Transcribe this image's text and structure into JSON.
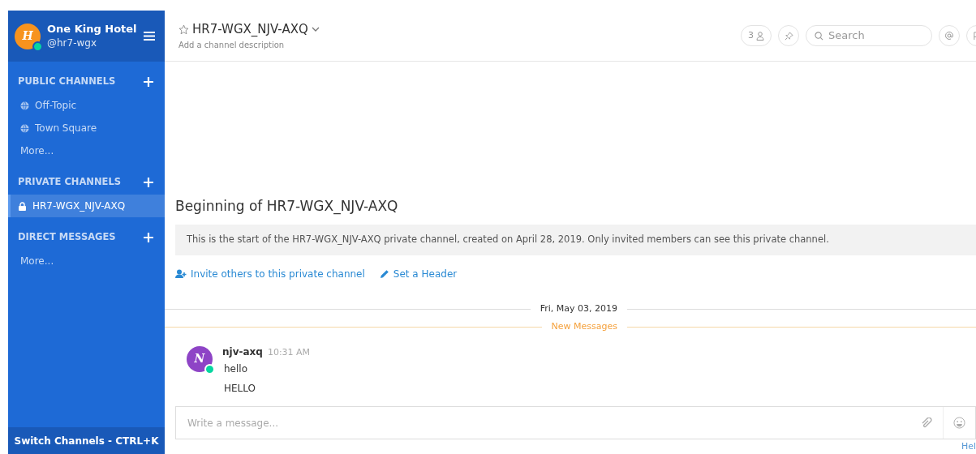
{
  "team": {
    "name": "One King Hotel",
    "username": "@hr7-wgx",
    "avatar_letter": "H",
    "online": true
  },
  "sidebar": {
    "sections": [
      {
        "title": "PUBLIC CHANNELS",
        "items": [
          {
            "label": "Off-Topic",
            "kind": "public",
            "selected": false
          },
          {
            "label": "Town Square",
            "kind": "public",
            "selected": false
          },
          {
            "label": "More...",
            "kind": "more",
            "selected": false
          }
        ]
      },
      {
        "title": "PRIVATE CHANNELS",
        "items": [
          {
            "label": "HR7-WGX_NJV-AXQ",
            "kind": "private",
            "selected": true
          }
        ]
      },
      {
        "title": "DIRECT MESSAGES",
        "items": [
          {
            "label": "More...",
            "kind": "more",
            "selected": false
          }
        ]
      }
    ],
    "switch_channels": "Switch Channels - CTRL+K"
  },
  "channel_header": {
    "title": "HR7-WGX_NJV-AXQ",
    "description": "Add a channel description",
    "member_count": "3",
    "search": {
      "placeholder": "Search"
    }
  },
  "intro": {
    "title": "Beginning of HR7-WGX_NJV-AXQ",
    "text": "This is the start of the HR7-WGX_NJV-AXQ private channel, created on April 28, 2019. Only invited members can see this private channel.",
    "actions": [
      {
        "label": "Invite others to this private channel",
        "kind": "invite"
      },
      {
        "label": "Set a Header",
        "kind": "header"
      }
    ]
  },
  "date_separator": "Fri, May 03, 2019",
  "new_messages": "New Messages",
  "messages": [
    {
      "author": "njv-axq",
      "time": "10:31 AM",
      "avatar_letter": "N",
      "online": true,
      "lines": [
        "hello",
        "HELLO"
      ]
    }
  ],
  "composer": {
    "placeholder": "Write a message...",
    "help": "Hel"
  }
}
